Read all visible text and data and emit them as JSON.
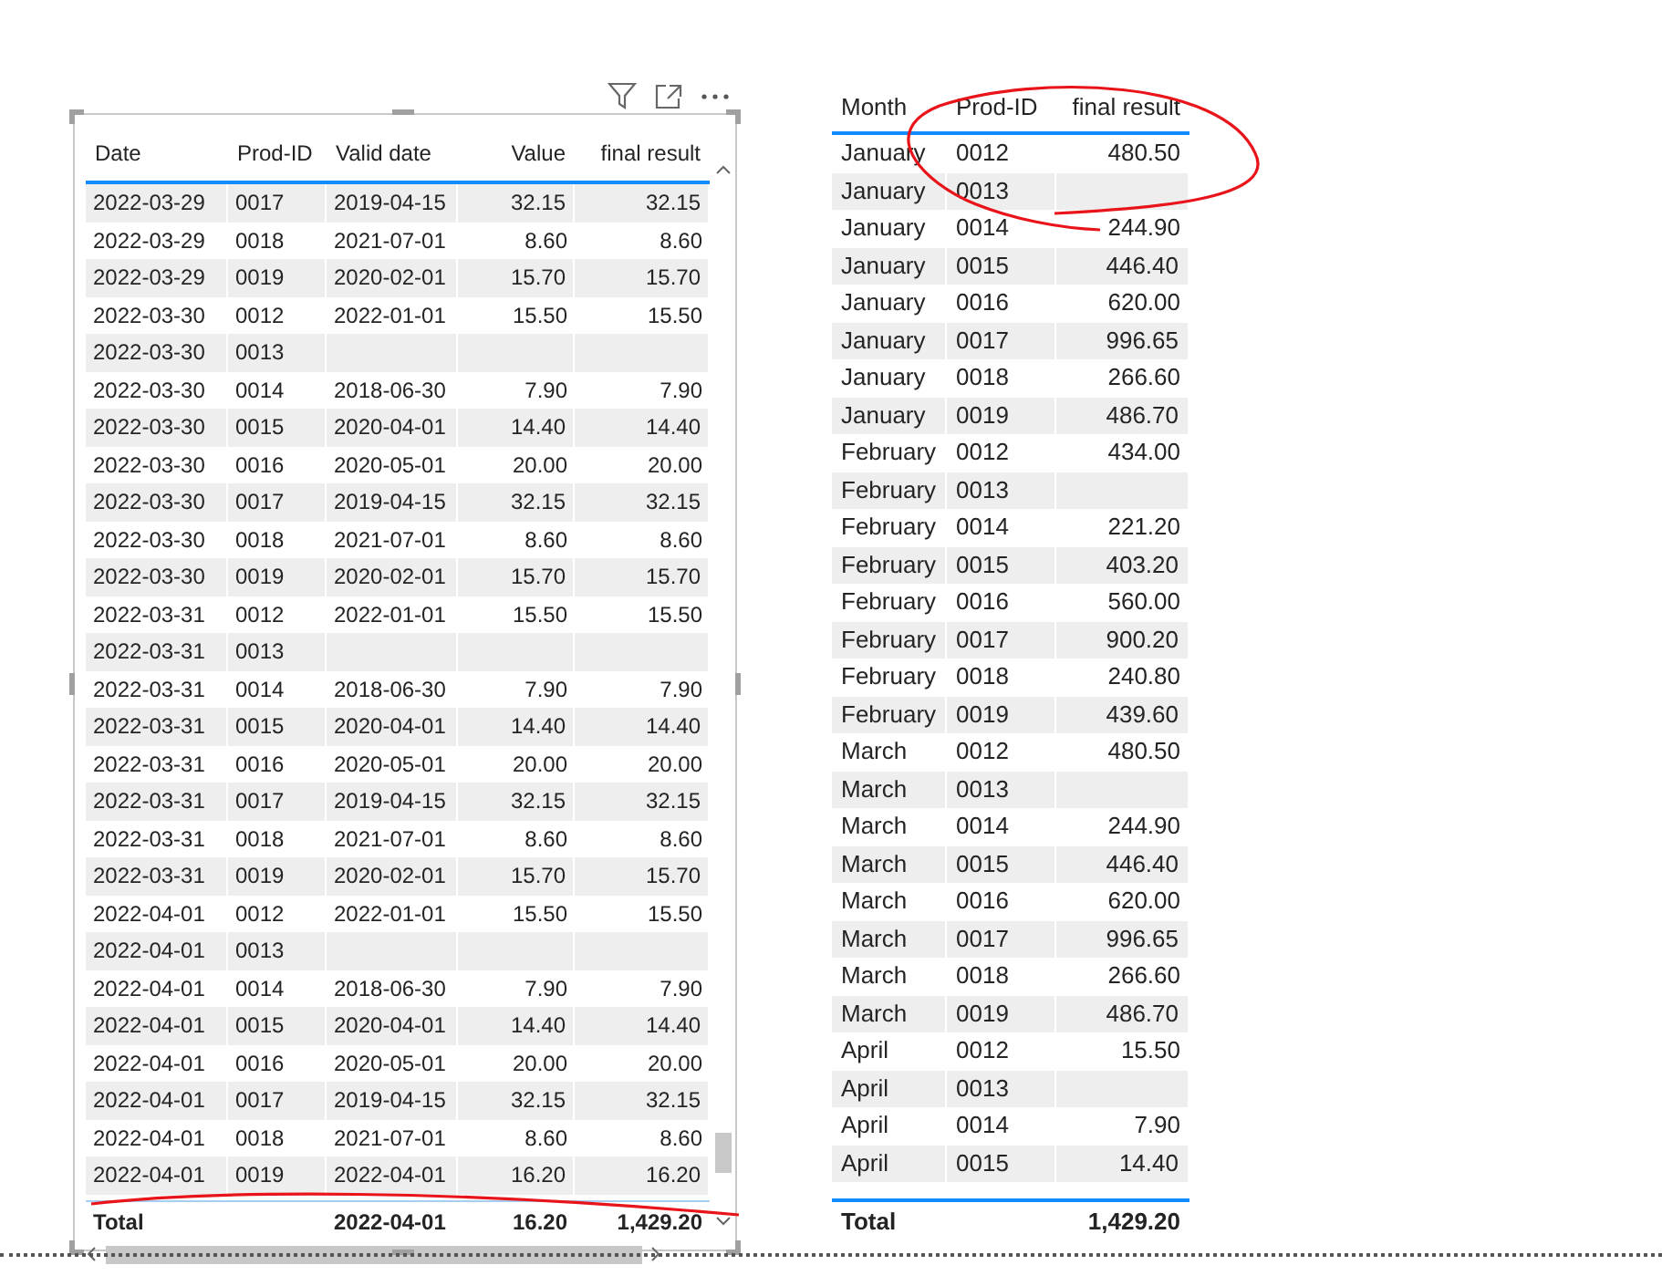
{
  "left_table": {
    "columns": [
      "Date",
      "Prod-ID",
      "Valid date",
      "Value",
      "final result"
    ],
    "rows": [
      {
        "date": "2022-03-29",
        "prod_id": "0017",
        "valid_date": "2019-04-15",
        "value": "32.15",
        "final_result": "32.15"
      },
      {
        "date": "2022-03-29",
        "prod_id": "0018",
        "valid_date": "2021-07-01",
        "value": "8.60",
        "final_result": "8.60"
      },
      {
        "date": "2022-03-29",
        "prod_id": "0019",
        "valid_date": "2020-02-01",
        "value": "15.70",
        "final_result": "15.70"
      },
      {
        "date": "2022-03-30",
        "prod_id": "0012",
        "valid_date": "2022-01-01",
        "value": "15.50",
        "final_result": "15.50"
      },
      {
        "date": "2022-03-30",
        "prod_id": "0013"
      },
      {
        "date": "2022-03-30",
        "prod_id": "0014",
        "valid_date": "2018-06-30",
        "value": "7.90",
        "final_result": "7.90"
      },
      {
        "date": "2022-03-30",
        "prod_id": "0015",
        "valid_date": "2020-04-01",
        "value": "14.40",
        "final_result": "14.40"
      },
      {
        "date": "2022-03-30",
        "prod_id": "0016",
        "valid_date": "2020-05-01",
        "value": "20.00",
        "final_result": "20.00"
      },
      {
        "date": "2022-03-30",
        "prod_id": "0017",
        "valid_date": "2019-04-15",
        "value": "32.15",
        "final_result": "32.15"
      },
      {
        "date": "2022-03-30",
        "prod_id": "0018",
        "valid_date": "2021-07-01",
        "value": "8.60",
        "final_result": "8.60"
      },
      {
        "date": "2022-03-30",
        "prod_id": "0019",
        "valid_date": "2020-02-01",
        "value": "15.70",
        "final_result": "15.70"
      },
      {
        "date": "2022-03-31",
        "prod_id": "0012",
        "valid_date": "2022-01-01",
        "value": "15.50",
        "final_result": "15.50"
      },
      {
        "date": "2022-03-31",
        "prod_id": "0013"
      },
      {
        "date": "2022-03-31",
        "prod_id": "0014",
        "valid_date": "2018-06-30",
        "value": "7.90",
        "final_result": "7.90"
      },
      {
        "date": "2022-03-31",
        "prod_id": "0015",
        "valid_date": "2020-04-01",
        "value": "14.40",
        "final_result": "14.40"
      },
      {
        "date": "2022-03-31",
        "prod_id": "0016",
        "valid_date": "2020-05-01",
        "value": "20.00",
        "final_result": "20.00"
      },
      {
        "date": "2022-03-31",
        "prod_id": "0017",
        "valid_date": "2019-04-15",
        "value": "32.15",
        "final_result": "32.15"
      },
      {
        "date": "2022-03-31",
        "prod_id": "0018",
        "valid_date": "2021-07-01",
        "value": "8.60",
        "final_result": "8.60"
      },
      {
        "date": "2022-03-31",
        "prod_id": "0019",
        "valid_date": "2020-02-01",
        "value": "15.70",
        "final_result": "15.70"
      },
      {
        "date": "2022-04-01",
        "prod_id": "0012",
        "valid_date": "2022-01-01",
        "value": "15.50",
        "final_result": "15.50"
      },
      {
        "date": "2022-04-01",
        "prod_id": "0013"
      },
      {
        "date": "2022-04-01",
        "prod_id": "0014",
        "valid_date": "2018-06-30",
        "value": "7.90",
        "final_result": "7.90"
      },
      {
        "date": "2022-04-01",
        "prod_id": "0015",
        "valid_date": "2020-04-01",
        "value": "14.40",
        "final_result": "14.40"
      },
      {
        "date": "2022-04-01",
        "prod_id": "0016",
        "valid_date": "2020-05-01",
        "value": "20.00",
        "final_result": "20.00"
      },
      {
        "date": "2022-04-01",
        "prod_id": "0017",
        "valid_date": "2019-04-15",
        "value": "32.15",
        "final_result": "32.15"
      },
      {
        "date": "2022-04-01",
        "prod_id": "0018",
        "valid_date": "2021-07-01",
        "value": "8.60",
        "final_result": "8.60"
      },
      {
        "date": "2022-04-01",
        "prod_id": "0019",
        "valid_date": "2022-04-01",
        "value": "16.20",
        "final_result": "16.20"
      }
    ],
    "total": {
      "label": "Total",
      "valid_date": "2022-04-01",
      "value": "16.20",
      "final_result": "1,429.20"
    }
  },
  "right_table": {
    "columns": [
      "Month",
      "Prod-ID",
      "final result"
    ],
    "rows": [
      {
        "month": "January",
        "prod_id": "0012",
        "final_result": "480.50"
      },
      {
        "month": "January",
        "prod_id": "0013"
      },
      {
        "month": "January",
        "prod_id": "0014",
        "final_result": "244.90"
      },
      {
        "month": "January",
        "prod_id": "0015",
        "final_result": "446.40"
      },
      {
        "month": "January",
        "prod_id": "0016",
        "final_result": "620.00"
      },
      {
        "month": "January",
        "prod_id": "0017",
        "final_result": "996.65"
      },
      {
        "month": "January",
        "prod_id": "0018",
        "final_result": "266.60"
      },
      {
        "month": "January",
        "prod_id": "0019",
        "final_result": "486.70"
      },
      {
        "month": "February",
        "prod_id": "0012",
        "final_result": "434.00"
      },
      {
        "month": "February",
        "prod_id": "0013"
      },
      {
        "month": "February",
        "prod_id": "0014",
        "final_result": "221.20"
      },
      {
        "month": "February",
        "prod_id": "0015",
        "final_result": "403.20"
      },
      {
        "month": "February",
        "prod_id": "0016",
        "final_result": "560.00"
      },
      {
        "month": "February",
        "prod_id": "0017",
        "final_result": "900.20"
      },
      {
        "month": "February",
        "prod_id": "0018",
        "final_result": "240.80"
      },
      {
        "month": "February",
        "prod_id": "0019",
        "final_result": "439.60"
      },
      {
        "month": "March",
        "prod_id": "0012",
        "final_result": "480.50"
      },
      {
        "month": "March",
        "prod_id": "0013"
      },
      {
        "month": "March",
        "prod_id": "0014",
        "final_result": "244.90"
      },
      {
        "month": "March",
        "prod_id": "0015",
        "final_result": "446.40"
      },
      {
        "month": "March",
        "prod_id": "0016",
        "final_result": "620.00"
      },
      {
        "month": "March",
        "prod_id": "0017",
        "final_result": "996.65"
      },
      {
        "month": "March",
        "prod_id": "0018",
        "final_result": "266.60"
      },
      {
        "month": "March",
        "prod_id": "0019",
        "final_result": "486.70"
      },
      {
        "month": "April",
        "prod_id": "0012",
        "final_result": "15.50"
      },
      {
        "month": "April",
        "prod_id": "0013"
      },
      {
        "month": "April",
        "prod_id": "0014",
        "final_result": "7.90"
      },
      {
        "month": "April",
        "prod_id": "0015",
        "final_result": "14.40"
      }
    ],
    "total": {
      "label": "Total",
      "final_result": "1,429.20"
    }
  }
}
